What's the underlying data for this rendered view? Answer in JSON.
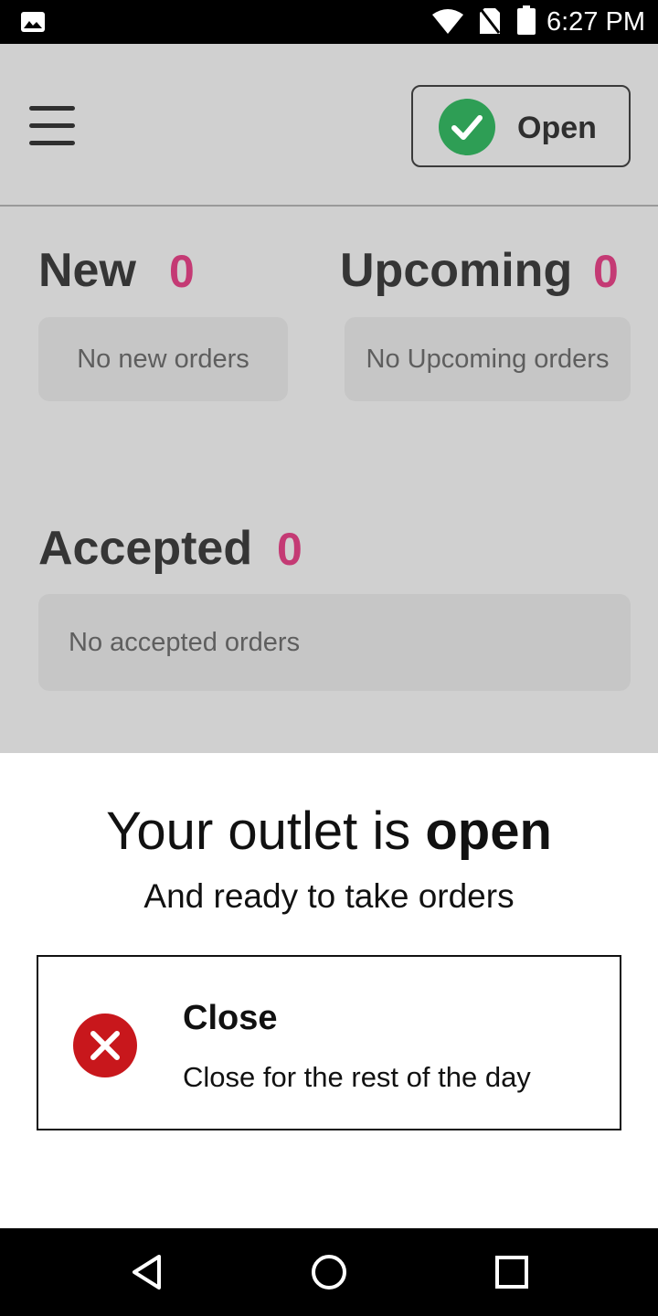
{
  "status_bar": {
    "time": "6:27 PM",
    "icons": [
      "gallery-icon",
      "wifi-icon",
      "no-sim-icon",
      "battery-icon"
    ]
  },
  "toolbar": {
    "menu_icon": "hamburger-menu-icon",
    "status_toggle": {
      "label": "Open",
      "icon": "check-circle-icon",
      "icon_color": "#2e9e55"
    }
  },
  "sections": {
    "new": {
      "title": "New",
      "count": "0",
      "empty_text": "No new orders"
    },
    "upcoming": {
      "title": "Upcoming",
      "count": "0",
      "empty_text": "No Upcoming orders"
    },
    "accepted": {
      "title": "Accepted",
      "count": "0",
      "empty_text": "No accepted orders"
    }
  },
  "sheet": {
    "title_prefix": "Your outlet is ",
    "title_emphasis": "open",
    "subtitle": "And ready to take orders",
    "close_option": {
      "icon": "close-circle-icon",
      "icon_color": "#c8171c",
      "title": "Close",
      "description": "Close for the rest of the day"
    }
  },
  "nav_bar": {
    "buttons": [
      "back-icon",
      "home-icon",
      "recents-icon"
    ]
  },
  "colors": {
    "count_accent": "#c43a74",
    "dim_overlay": "#d0d0d0"
  }
}
